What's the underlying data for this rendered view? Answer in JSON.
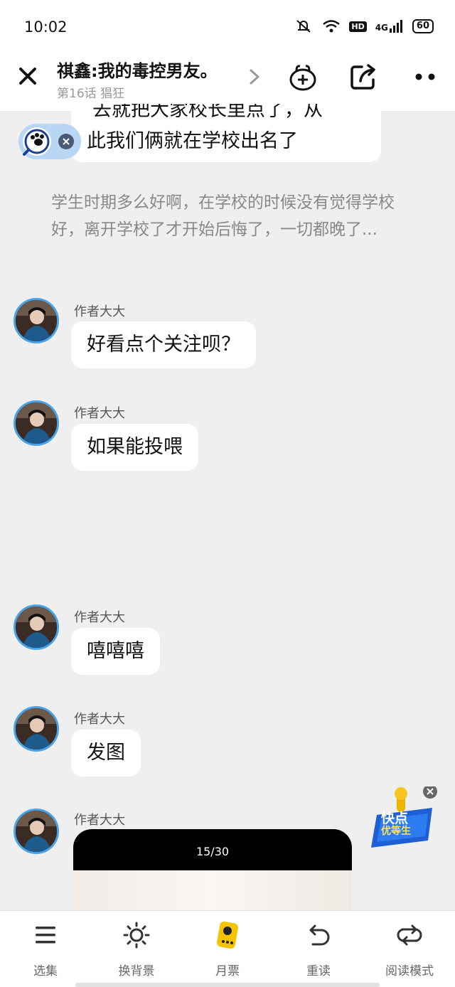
{
  "status_bar": {
    "time": "10:02",
    "hd_badge": "HD",
    "network": "4G",
    "battery": "60"
  },
  "header": {
    "title": "祺鑫:我的毒控男友。",
    "subtitle": "第16话 猖狂"
  },
  "messages": [
    {
      "author": "",
      "text": "此我们俩就在学校出名了",
      "partial_text": "去就把大家校长里点了，从"
    },
    {
      "author": "作者大大",
      "text": "好看点个关注呗？"
    },
    {
      "author": "作者大大",
      "text": "如果能投喂"
    },
    {
      "author": "作者大大",
      "text": "嘻嘻嘻"
    },
    {
      "author": "作者大大",
      "text": "发图"
    },
    {
      "author": "作者大大",
      "text": ""
    }
  ],
  "narration": "学生时期多么好啊，在学校的时候没有觉得学校好，离开学校了才开始后悔了，一切都晚了...",
  "image_card": {
    "page_counter": "15/30"
  },
  "promo": {
    "line1": "快点",
    "line2": "优等生"
  },
  "bottom_bar": {
    "tabs": [
      {
        "label": "选集",
        "icon": "list-icon"
      },
      {
        "label": "换背景",
        "icon": "sun-icon"
      },
      {
        "label": "月票",
        "icon": "ticket-icon"
      },
      {
        "label": "重读",
        "icon": "reread-icon"
      },
      {
        "label": "阅读模式",
        "icon": "mode-icon"
      }
    ]
  },
  "colors": {
    "background": "#efefef",
    "avatar_ring": "#4aa3e6",
    "accent": "#f5c400"
  }
}
